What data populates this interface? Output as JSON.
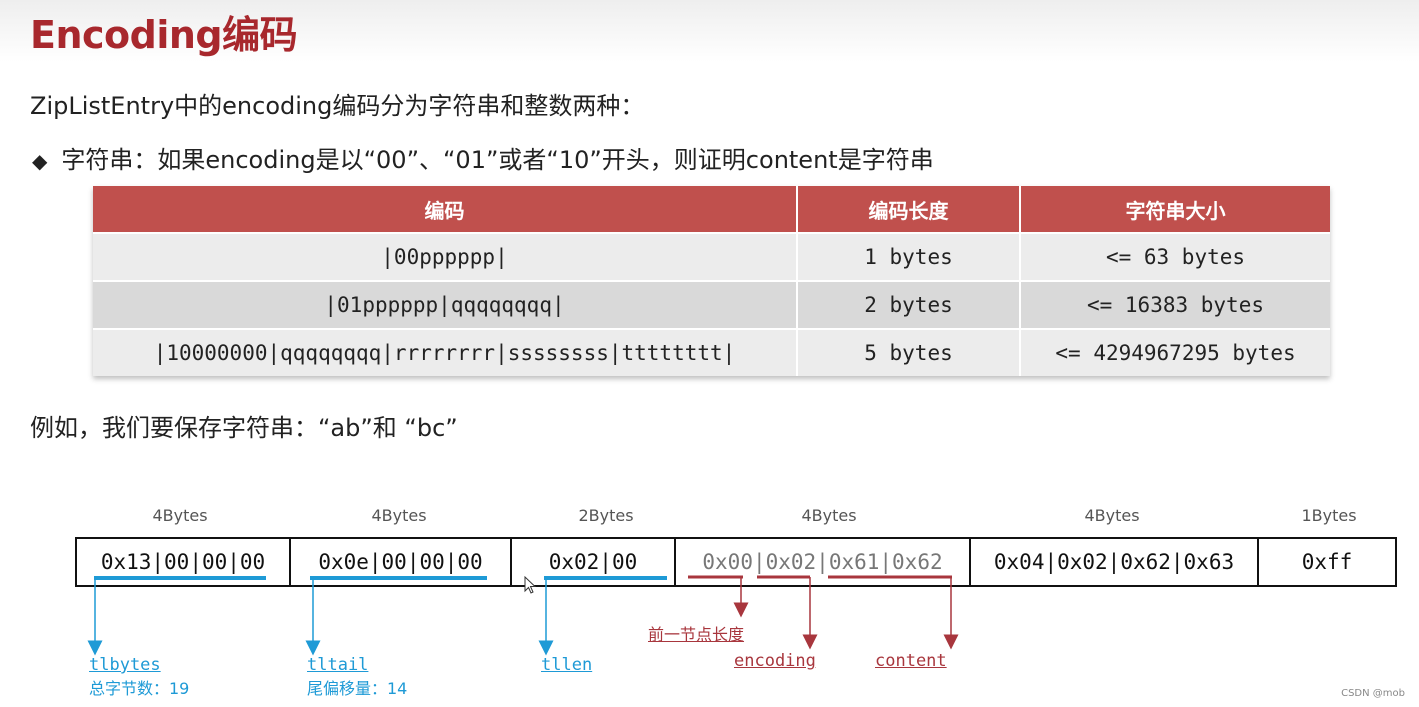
{
  "title": "Encoding编码",
  "intro": "ZipListEntry中的encoding编码分为字符串和整数两种：",
  "bullet": "字符串：如果encoding是以“00”、“01”或者“10”开头，则证明content是字符串",
  "table": {
    "headers": [
      "编码",
      "编码长度",
      "字符串大小"
    ],
    "rows": [
      [
        "|00pppppp|",
        "1 bytes",
        "<= 63 bytes"
      ],
      [
        "|01pppppp|qqqqqqqq|",
        "2 bytes",
        "<= 16383 bytes"
      ],
      [
        "|10000000|qqqqqqqq|rrrrrrrr|ssssssss|tttttttt|",
        "5 bytes",
        "<= 4294967295 bytes"
      ]
    ]
  },
  "example": "例如，我们要保存字符串：“ab”和 “bc”",
  "diagram": {
    "byte_labels": [
      "4Bytes",
      "4Bytes",
      "2Bytes",
      "4Bytes",
      "4Bytes",
      "1Bytes"
    ],
    "cells": [
      "0x13|00|00|00",
      "0x0e|00|00|00",
      "0x02|00",
      "0x00|0x02|0x61|0x62",
      "0x04|0x02|0x62|0x63",
      "0xff"
    ],
    "annotations": {
      "tlbytes": "tlbytes",
      "tlbytes_desc": "总字节数：19",
      "tltail": "tltail",
      "tltail_desc": "尾偏移量：14",
      "tllen": "tllen",
      "prev_len": "前一节点长度",
      "encoding": "encoding",
      "content": "content"
    },
    "colors": {
      "blue": "#1e9ad6",
      "red": "#a8363d"
    }
  },
  "watermark": "CSDN @mob"
}
